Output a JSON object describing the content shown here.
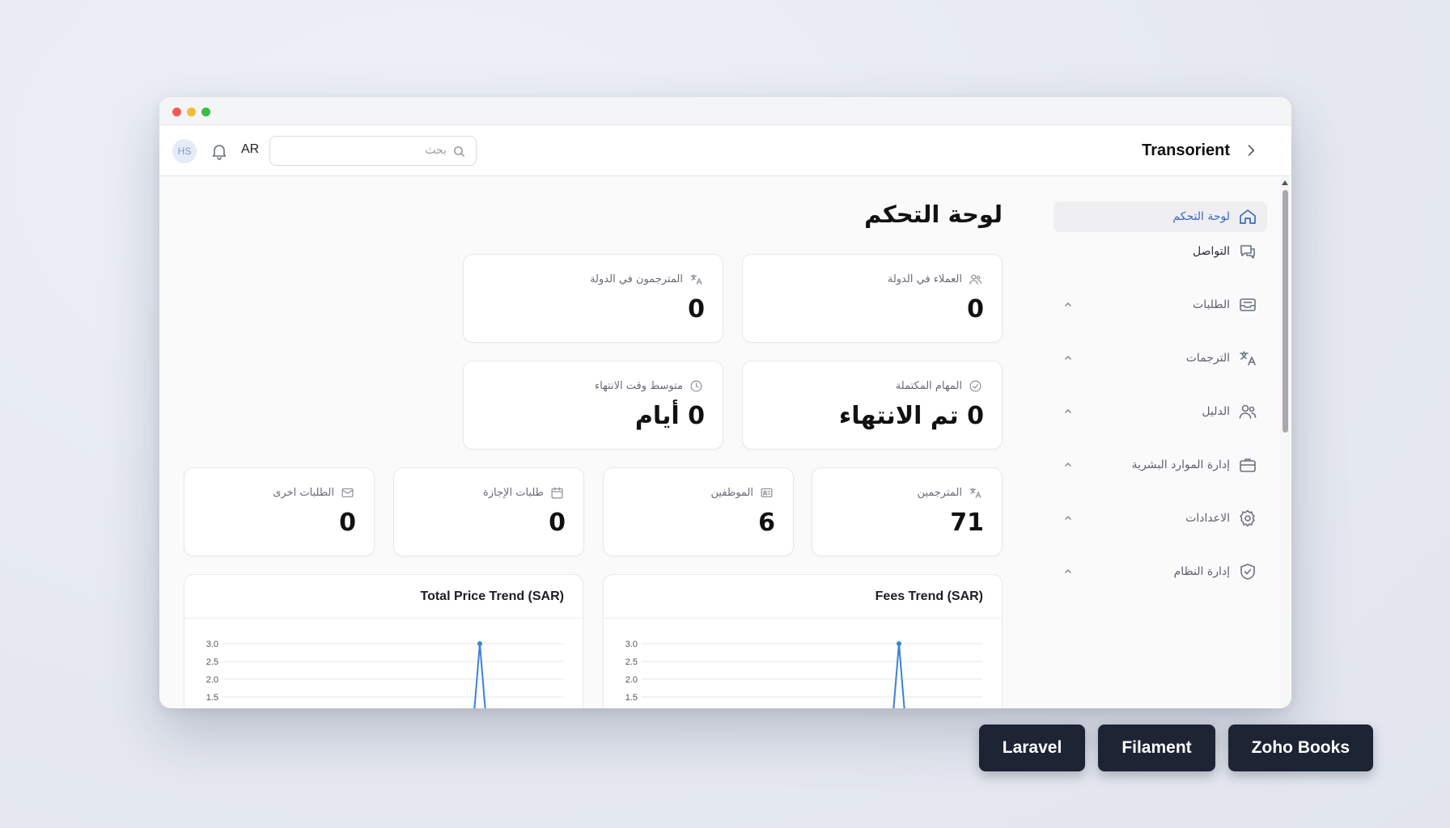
{
  "window": {
    "controls": [
      "close",
      "minimize",
      "maximize"
    ]
  },
  "topbar": {
    "avatar_initials": "HS",
    "language": "AR",
    "search_placeholder": "بحث",
    "brand": "Transorient"
  },
  "sidebar": {
    "items": [
      {
        "label": "لوحة التحكم",
        "icon": "home-icon",
        "active": true
      },
      {
        "label": "التواصل",
        "icon": "chat-icon"
      },
      {
        "label": "الطلبات",
        "icon": "inbox-icon",
        "expandable": true
      },
      {
        "label": "الترجمات",
        "icon": "translate-icon",
        "expandable": true
      },
      {
        "label": "الدليل",
        "icon": "users-icon",
        "expandable": true
      },
      {
        "label": "إدارة الموارد البشرية",
        "icon": "briefcase-icon",
        "expandable": true
      },
      {
        "label": "الاعدادات",
        "icon": "gear-icon",
        "expandable": true
      },
      {
        "label": "إدارة النظام",
        "icon": "shield-icon",
        "expandable": true
      }
    ]
  },
  "main": {
    "title": "لوحة التحكم",
    "stats_top": [
      {
        "label": "العملاء في الدولة",
        "value": "0",
        "icon": "users-icon"
      },
      {
        "label": "المترجمون في الدولة",
        "value": "0",
        "icon": "translate-icon"
      },
      {
        "label": "المهام المكتملة",
        "value": "0 تم الانتهاء",
        "icon": "check-circle-icon"
      },
      {
        "label": "متوسط وقت الانتهاء",
        "value": "0 أيام",
        "icon": "clock-icon"
      }
    ],
    "stats_row": [
      {
        "label": "المترجمين",
        "value": "71",
        "icon": "translate-icon"
      },
      {
        "label": "الموظفين",
        "value": "6",
        "icon": "id-card-icon"
      },
      {
        "label": "طلبات الإجازة",
        "value": "0",
        "icon": "calendar-icon"
      },
      {
        "label": "الطلبات اخرى",
        "value": "0",
        "icon": "mail-icon"
      }
    ]
  },
  "chart_data": [
    {
      "type": "line",
      "title": "Fees Trend (SAR)",
      "yticks": [
        "3.0",
        "2.5",
        "2.0",
        "1.5"
      ],
      "ylim": [
        1.5,
        3.0
      ],
      "color": "#3b82d6",
      "peak_value": 3.0
    },
    {
      "type": "line",
      "title": "Total Price Trend (SAR)",
      "yticks": [
        "3.0",
        "2.5",
        "2.0",
        "1.5"
      ],
      "ylim": [
        1.5,
        3.0
      ],
      "color": "#3b82d6",
      "peak_value": 3.0
    }
  ],
  "tags": [
    "Laravel",
    "Filament",
    "Zoho Books"
  ]
}
